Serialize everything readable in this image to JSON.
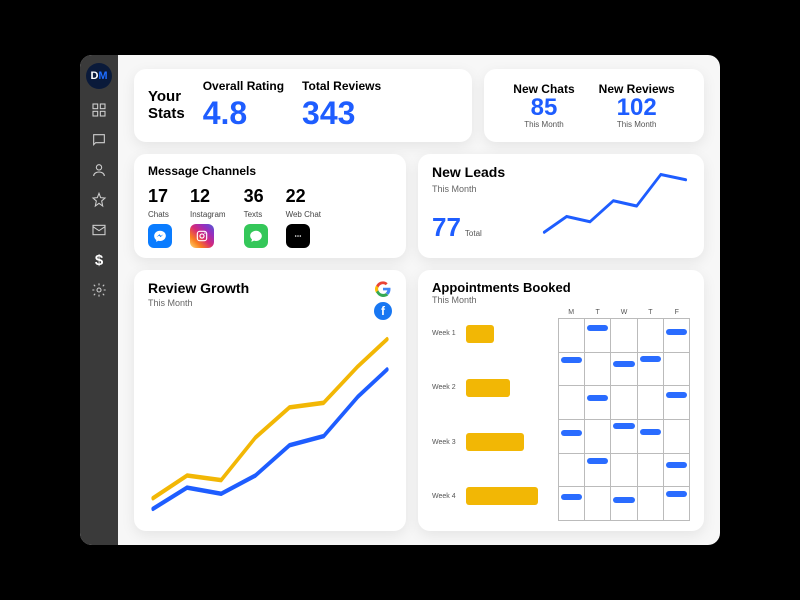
{
  "sidebar": {
    "logo_text": "DM",
    "items": [
      {
        "name": "grid",
        "label": "Dashboard"
      },
      {
        "name": "chat",
        "label": "Chat"
      },
      {
        "name": "user",
        "label": "Contacts"
      },
      {
        "name": "star",
        "label": "Reviews"
      },
      {
        "name": "mail",
        "label": "Inbox"
      },
      {
        "name": "dollar",
        "label": "Billing"
      },
      {
        "name": "gear",
        "label": "Settings"
      }
    ]
  },
  "stats": {
    "title_line1": "Your",
    "title_line2": "Stats",
    "overall_rating_label": "Overall Rating",
    "overall_rating_value": "4.8",
    "total_reviews_label": "Total Reviews",
    "total_reviews_value": "343"
  },
  "new_metrics": {
    "new_chats_label": "New Chats",
    "new_chats_value": "85",
    "new_reviews_label": "New Reviews",
    "new_reviews_value": "102",
    "period": "This Month"
  },
  "channels": {
    "title": "Message Channels",
    "items": [
      {
        "value": "17",
        "label": "Chats",
        "icon": "messenger"
      },
      {
        "value": "12",
        "label": "Instagram",
        "icon": "instagram"
      },
      {
        "value": "36",
        "label": "Texts",
        "icon": "sms"
      },
      {
        "value": "22",
        "label": "Web Chat",
        "icon": "webchat"
      }
    ]
  },
  "leads": {
    "title": "New Leads",
    "subtitle": "This Month",
    "total_value": "77",
    "total_label": "Total"
  },
  "growth": {
    "title": "Review Growth",
    "subtitle": "This Month",
    "legend": [
      "google",
      "facebook"
    ]
  },
  "appointments": {
    "title": "Appointments Booked",
    "subtitle": "This Month",
    "weeks": [
      {
        "label": "Week 1",
        "value": 30
      },
      {
        "label": "Week 2",
        "value": 50
      },
      {
        "label": "Week 3",
        "value": 68
      },
      {
        "label": "Week 4",
        "value": 82
      }
    ],
    "days": [
      "M",
      "T",
      "W",
      "T",
      "F"
    ]
  },
  "chart_data": [
    {
      "type": "line",
      "name": "new_leads",
      "title": "New Leads",
      "subtitle": "This Month",
      "x": [
        1,
        2,
        3,
        4,
        5,
        6,
        7
      ],
      "values": [
        20,
        35,
        30,
        50,
        45,
        78,
        72
      ],
      "ylim": [
        0,
        100
      ],
      "color": "#1e5dff"
    },
    {
      "type": "line",
      "name": "review_growth",
      "title": "Review Growth",
      "subtitle": "This Month",
      "x": [
        1,
        2,
        3,
        4,
        5,
        6,
        7,
        8
      ],
      "series": [
        {
          "name": "google",
          "color": "#f2b705",
          "values": [
            15,
            28,
            25,
            42,
            55,
            58,
            75,
            90
          ]
        },
        {
          "name": "facebook",
          "color": "#1e5dff",
          "values": [
            10,
            22,
            20,
            28,
            40,
            45,
            62,
            75
          ]
        }
      ],
      "ylim": [
        0,
        100
      ]
    },
    {
      "type": "bar",
      "name": "appointments_weeks",
      "title": "Appointments Booked",
      "categories": [
        "Week 1",
        "Week 2",
        "Week 3",
        "Week 4"
      ],
      "values": [
        30,
        50,
        68,
        82
      ],
      "ylim": [
        0,
        100
      ],
      "color": "#f2b705"
    }
  ]
}
